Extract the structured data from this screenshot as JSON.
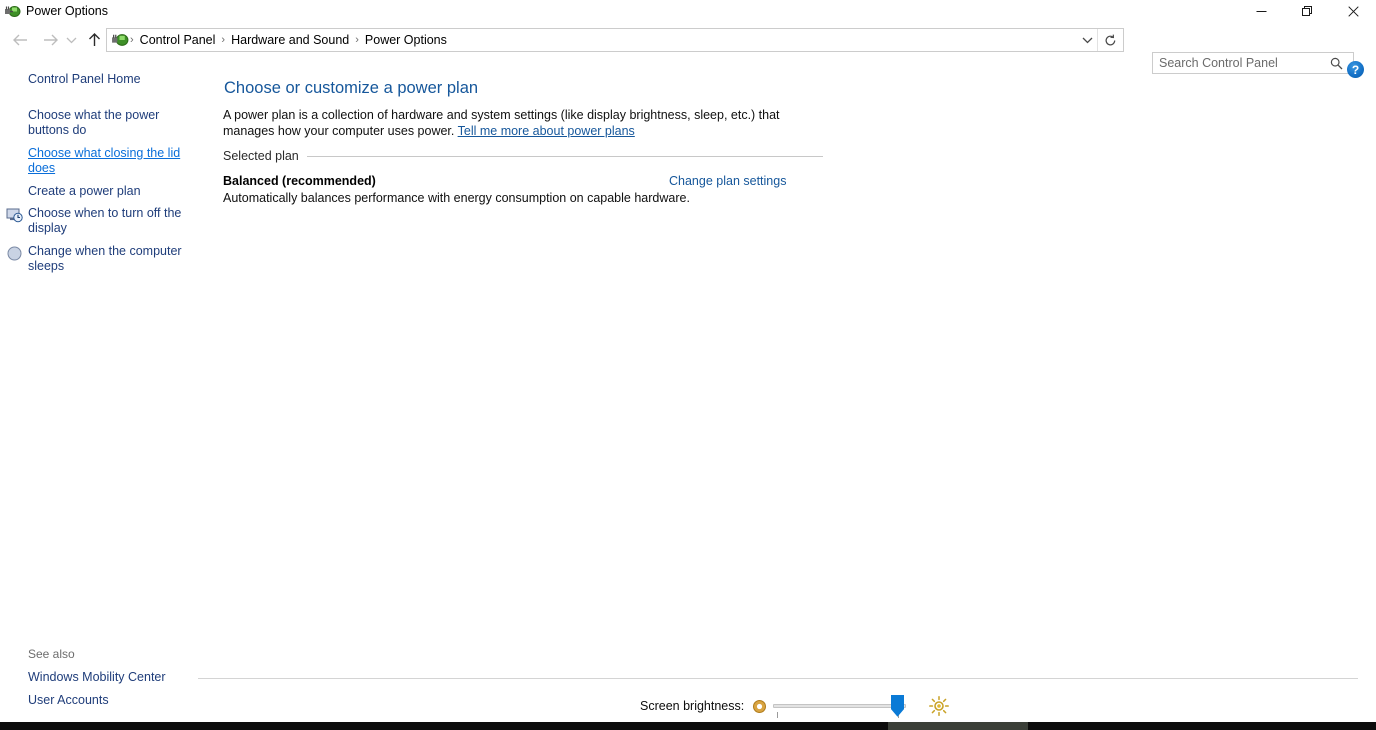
{
  "window": {
    "title": "Power Options",
    "icon": "power-plug-battery-icon",
    "minimize_label": "Minimize",
    "maximize_label": "Restore",
    "close_label": "Close"
  },
  "nav": {
    "back_label": "Back",
    "forward_label": "Forward",
    "recent_label": "Recent locations",
    "up_label": "Up one level",
    "breadcrumbs": [
      "Control Panel",
      "Hardware and Sound",
      "Power Options"
    ],
    "separator": "›",
    "dropdown_label": "Previous locations",
    "refresh_label": "Refresh"
  },
  "search": {
    "placeholder": "Search Control Panel",
    "value": "",
    "icon": "search-icon"
  },
  "help": {
    "label": "?"
  },
  "sidebar": {
    "home_label": "Control Panel Home",
    "items": [
      {
        "label": "Choose what the power buttons do",
        "icon": null,
        "hovered": false
      },
      {
        "label": "Choose what closing the lid does",
        "icon": null,
        "hovered": true
      },
      {
        "label": "Create a power plan",
        "icon": null,
        "hovered": false
      },
      {
        "label": "Choose when to turn off the display",
        "icon": "display-clock-icon",
        "hovered": false
      },
      {
        "label": "Change when the computer sleeps",
        "icon": "moon-sleep-icon",
        "hovered": false
      }
    ],
    "see_also_label": "See also",
    "see_also_items": [
      "Windows Mobility Center",
      "User Accounts"
    ]
  },
  "content": {
    "title": "Choose or customize a power plan",
    "intro_part1": "A power plan is a collection of hardware and system settings (like display brightness, sleep, etc.) that manages how your computer uses power. ",
    "intro_link": "Tell me more about power plans",
    "group_label": "Selected plan",
    "plan_name": "Balanced (recommended)",
    "plan_description": "Automatically balances performance with energy consumption on capable hardware.",
    "change_plan_link": "Change plan settings"
  },
  "brightness": {
    "label": "Screen brightness:",
    "dim_icon": "dim-sun-icon",
    "bright_icon": "bright-sun-icon",
    "value": 89,
    "min": 0,
    "max": 100
  },
  "colors": {
    "link": "#16579b",
    "link_hover": "#0a6ed9",
    "heading": "#16579b",
    "accent": "#0a6ed9",
    "slider_thumb": "#0a7ad6"
  }
}
